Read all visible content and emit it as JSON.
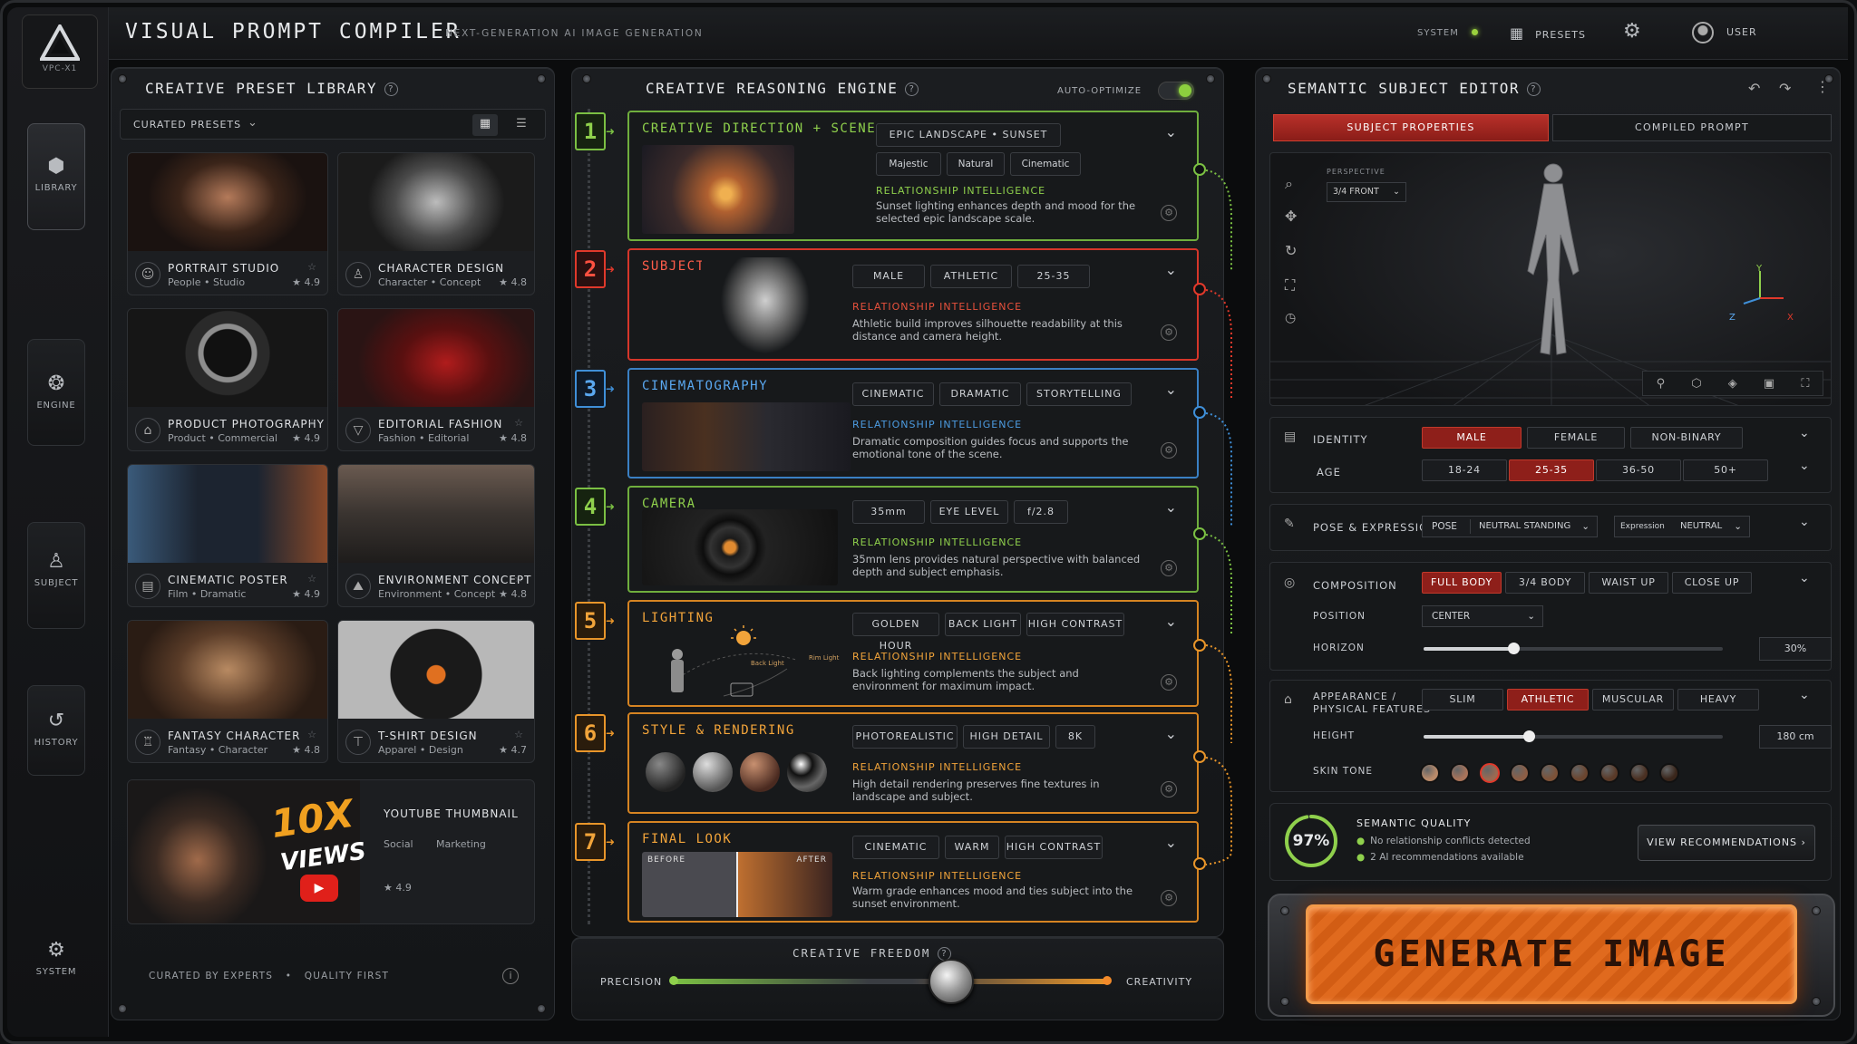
{
  "app": {
    "logo_text": "VPC-X1",
    "title": "VISUAL PROMPT COMPILER",
    "subtitle": "NEXT-GENERATION AI IMAGE GENERATION",
    "system_label": "SYSTEM",
    "presets_label": "PRESETS",
    "user_label": "USER"
  },
  "sidebar": {
    "items": [
      {
        "label": "LIBRARY",
        "icon": "cube-icon"
      },
      {
        "label": "ENGINE",
        "icon": "brain-icon"
      },
      {
        "label": "SUBJECT",
        "icon": "person-icon"
      },
      {
        "label": "HISTORY",
        "icon": "history-icon"
      },
      {
        "label": "SYSTEM",
        "icon": "gear-icon"
      }
    ]
  },
  "library": {
    "title": "CREATIVE PRESET LIBRARY",
    "dropdown": "CURATED PRESETS",
    "footer_left": "CURATED BY EXPERTS",
    "footer_sep": "•",
    "footer_right": "QUALITY FIRST",
    "presets": [
      {
        "name": "PORTRAIT STUDIO",
        "sub": "People  •  Studio",
        "rating": "4.9"
      },
      {
        "name": "CHARACTER DESIGN",
        "sub": "Character  •  Concept",
        "rating": "4.8"
      },
      {
        "name": "PRODUCT PHOTOGRAPHY",
        "sub": "Product  •  Commercial",
        "rating": "4.9"
      },
      {
        "name": "EDITORIAL FASHION",
        "sub": "Fashion  •  Editorial",
        "rating": "4.8"
      },
      {
        "name": "CINEMATIC POSTER",
        "sub": "Film  •  Dramatic",
        "rating": "4.9"
      },
      {
        "name": "ENVIRONMENT CONCEPT",
        "sub": "Environment  •  Concept",
        "rating": "4.8"
      },
      {
        "name": "FANTASY CHARACTER",
        "sub": "Fantasy  •  Character",
        "rating": "4.8"
      },
      {
        "name": "T-SHIRT DESIGN",
        "sub": "Apparel  •  Design",
        "rating": "4.7"
      }
    ],
    "featured": {
      "name": "YOUTUBE THUMBNAIL",
      "tag1": "Social",
      "tag2": "Marketing",
      "rating": "4.9",
      "art_top": "10X",
      "art_bottom": "VIEWS"
    }
  },
  "engine": {
    "title": "CREATIVE REASONING ENGINE",
    "auto_label": "AUTO-OPTIMIZE",
    "ri_label": "RELATIONSHIP INTELLIGENCE",
    "steps": [
      {
        "num": "1",
        "title": "CREATIVE DIRECTION + SCENE",
        "chips": [
          "EPIC LANDSCAPE  •  SUNSET",
          "Majestic",
          "Natural",
          "Cinematic"
        ],
        "desc": "Sunset lighting enhances depth and mood for the selected epic landscape scale.",
        "color": "#7bc043"
      },
      {
        "num": "2",
        "title": "SUBJECT",
        "chips": [
          "MALE",
          "ATHLETIC",
          "25-35"
        ],
        "desc": "Athletic build improves silhouette readability at this distance and camera height.",
        "color": "#e0392b"
      },
      {
        "num": "3",
        "title": "CINEMATOGRAPHY",
        "chips": [
          "CINEMATIC",
          "DRAMATIC",
          "STORYTELLING"
        ],
        "desc": "Dramatic composition guides focus and supports the emotional tone of the scene.",
        "color": "#3f8fd8"
      },
      {
        "num": "4",
        "title": "CAMERA",
        "chips": [
          "35mm",
          "EYE LEVEL",
          "f/2.8"
        ],
        "desc": "35mm lens provides natural perspective with balanced depth and subject emphasis.",
        "color": "#7bc043"
      },
      {
        "num": "5",
        "title": "LIGHTING",
        "chips": [
          "GOLDEN HOUR",
          "BACK LIGHT",
          "HIGH CONTRAST"
        ],
        "desc": "Back lighting complements the subject and environment for maximum impact.",
        "color": "#e8952a",
        "diag_back": "Back Light",
        "diag_rim": "Rim Light"
      },
      {
        "num": "6",
        "title": "STYLE & RENDERING",
        "chips": [
          "PHOTOREALISTIC",
          "HIGH DETAIL",
          "8K"
        ],
        "desc": "High detail rendering preserves fine textures in landscape and subject.",
        "color": "#e8952a"
      },
      {
        "num": "7",
        "title": "FINAL LOOK",
        "chips": [
          "CINEMATIC",
          "WARM",
          "HIGH CONTRAST"
        ],
        "desc": "Warm grade enhances mood and ties subject into the sunset environment.",
        "color": "#e8952a",
        "before": "BEFORE",
        "after": "AFTER"
      }
    ],
    "freedom": {
      "title": "CREATIVE FREEDOM",
      "left": "PRECISION",
      "right": "CREATIVITY",
      "value": 0.64
    }
  },
  "editor": {
    "title": "SEMANTIC SUBJECT EDITOR",
    "tab_active": "SUBJECT PROPERTIES",
    "tab_other": "COMPILED PROMPT",
    "perspective_label": "PERSPECTIVE",
    "perspective_value": "3/4 FRONT",
    "axis_y": "Y",
    "axis_z": "Z",
    "axis_x": "X",
    "identity": {
      "label": "IDENTITY",
      "options": [
        "MALE",
        "FEMALE",
        "NON-BINARY"
      ],
      "selected": "MALE"
    },
    "age": {
      "label": "AGE",
      "options": [
        "18-24",
        "25-35",
        "36-50",
        "50+"
      ],
      "selected": "25-35"
    },
    "pose": {
      "label": "POSE & EXPRESSION",
      "pose_key": "POSE",
      "pose_value": "NEUTRAL STANDING",
      "expr_key": "Expression",
      "expr_value": "NEUTRAL"
    },
    "composition": {
      "label": "COMPOSITION",
      "options": [
        "FULL BODY",
        "3/4 BODY",
        "WAIST UP",
        "CLOSE UP"
      ],
      "selected": "FULL BODY",
      "position_label": "POSITION",
      "position_value": "CENTER",
      "horizon_label": "HORIZON",
      "horizon_value": "30%",
      "horizon_level": 0.3
    },
    "appearance": {
      "label_line1": "APPEARANCE /",
      "label_line2": "PHYSICAL FEATURES",
      "options": [
        "SLIM",
        "ATHLETIC",
        "MUSCULAR",
        "HEAVY"
      ],
      "selected": "ATHLETIC",
      "height_label": "HEIGHT",
      "height_value": "180 cm",
      "height_level": 0.35,
      "skin_label": "SKIN TONE",
      "skin_tones": [
        "#b98a6a",
        "#a8735a",
        "#9a6a52",
        "#8d5e45",
        "#7d5238",
        "#6b452f",
        "#5a3a28",
        "#4a3022",
        "#3a261b"
      ],
      "skin_selected": 2
    },
    "quality": {
      "percent": "97%",
      "value": 0.97,
      "title": "SEMANTIC QUALITY",
      "line1": "No relationship conflicts detected",
      "line2": "2 AI recommendations available",
      "button": "VIEW RECOMMENDATIONS"
    },
    "generate": "GENERATE IMAGE"
  },
  "colors": {
    "accent_orange": "#e8952a",
    "accent_red": "#c0392b",
    "accent_green": "#7bc043",
    "accent_blue": "#3f8fd8"
  }
}
